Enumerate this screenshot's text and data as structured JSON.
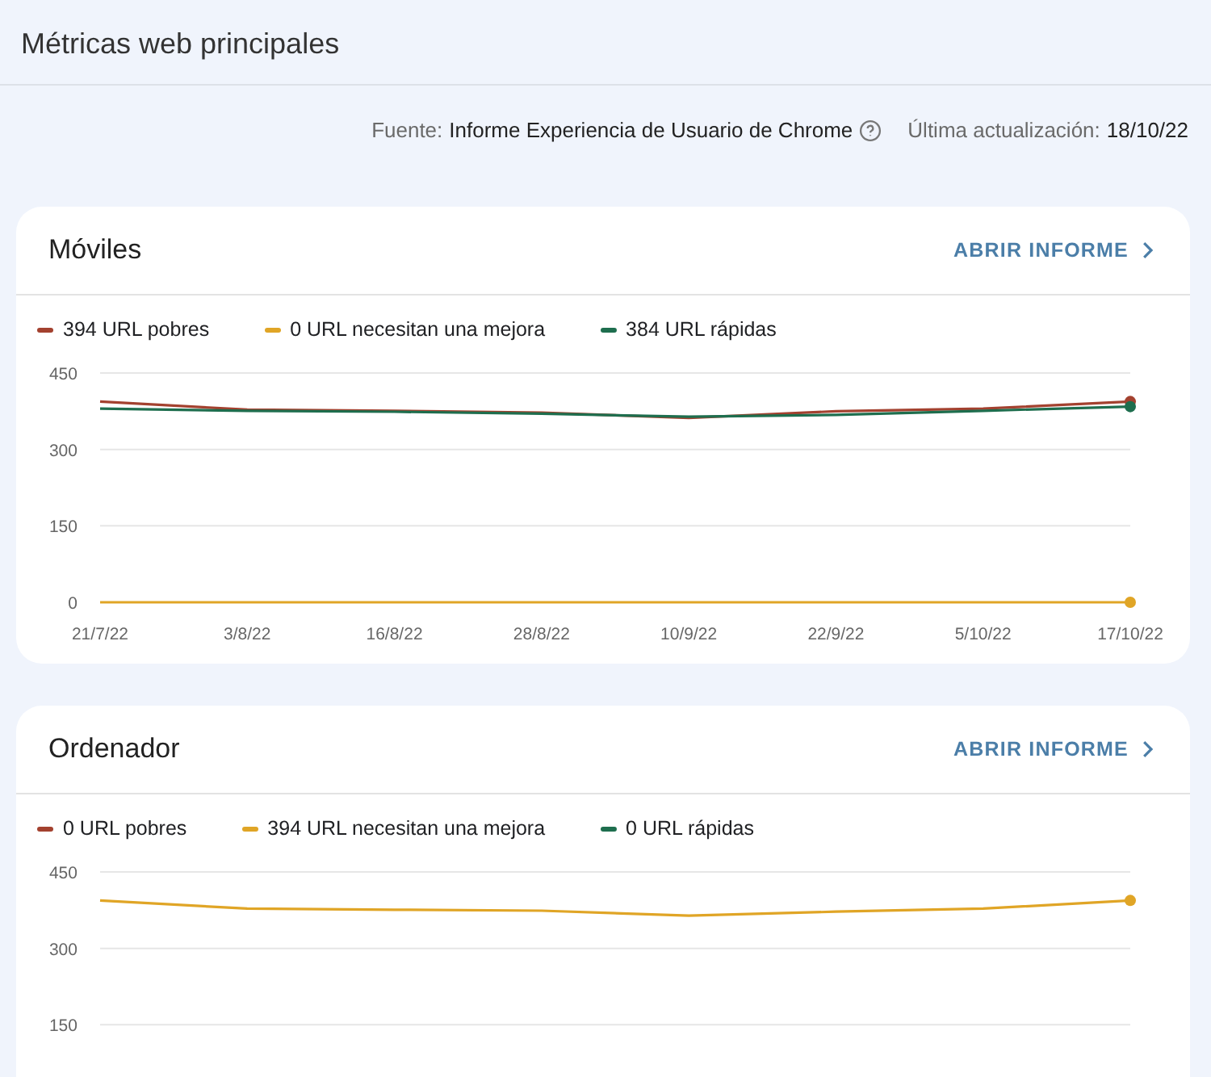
{
  "page": {
    "title": "Métricas web principales"
  },
  "source": {
    "label": "Fuente:",
    "value": "Informe Experiencia de Usuario de Chrome",
    "updated_label": "Última actualización:",
    "updated_value": "18/10/22"
  },
  "cards": [
    {
      "title": "Móviles",
      "link": "ABRIR INFORME",
      "chart_data": {
        "type": "line",
        "categories": [
          "21/7/22",
          "3/8/22",
          "16/8/22",
          "28/8/22",
          "10/9/22",
          "22/9/22",
          "5/10/22",
          "17/10/22"
        ],
        "yticks": [
          0,
          150,
          300,
          450
        ],
        "ylim": [
          0,
          450
        ],
        "series": [
          {
            "name": "394 URL pobres",
            "color": "#a3412f",
            "values": [
              394,
              378,
              376,
              372,
              362,
              375,
              380,
              394
            ]
          },
          {
            "name": "0 URL necesitan una mejora",
            "color": "#e0a526",
            "values": [
              0,
              0,
              0,
              0,
              0,
              0,
              0,
              0
            ]
          },
          {
            "name": "384 URL rápidas",
            "color": "#1e6e4e",
            "values": [
              380,
              376,
              374,
              370,
              364,
              368,
              376,
              384
            ]
          }
        ]
      }
    },
    {
      "title": "Ordenador",
      "link": "ABRIR INFORME",
      "chart_data": {
        "type": "line",
        "yticks": [
          150,
          300,
          450
        ],
        "ylim": [
          150,
          450
        ],
        "series": [
          {
            "name": "0 URL pobres",
            "color": "#a3412f",
            "values": [
              null,
              null,
              null,
              null,
              null,
              null,
              null,
              null
            ]
          },
          {
            "name": "394 URL necesitan una mejora",
            "color": "#e0a526",
            "values": [
              394,
              378,
              376,
              374,
              364,
              372,
              378,
              394
            ]
          },
          {
            "name": "0 URL rápidas",
            "color": "#1e6e4e",
            "values": [
              null,
              null,
              null,
              null,
              null,
              null,
              null,
              null
            ]
          }
        ]
      }
    }
  ]
}
